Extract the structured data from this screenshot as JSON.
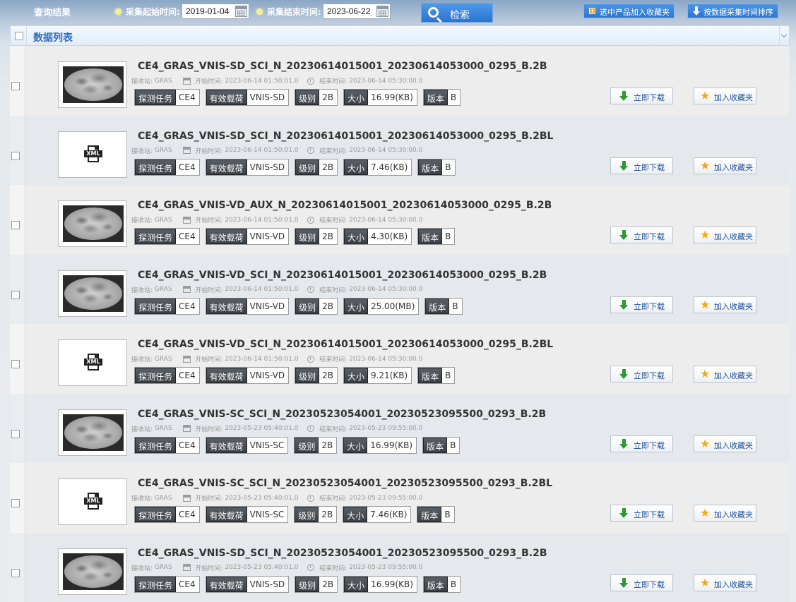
{
  "header": {
    "title": "查询结果",
    "start_label": "采集起始时间:",
    "start_value": "2019-01-04",
    "end_label": "采集结束时间:",
    "end_value": "2023-06-22",
    "search_label": "检索",
    "add_selected_label": "选中产品加入收藏夹",
    "sort_label": "按数据采集时间排序"
  },
  "list": {
    "title": "数据列表"
  },
  "labels": {
    "station": "接收站:",
    "start": "开始时间:",
    "end": "结束时间:",
    "task": "探测任务",
    "payload": "有效载荷",
    "level": "级别",
    "size": "大小",
    "version": "版本",
    "download": "立即下载",
    "favorite": "加入收藏夹"
  },
  "rows": [
    {
      "name": "CE4_GRAS_VNIS-SD_SCI_N_20230614015001_20230614053000_0295_B.2B",
      "thumb": "moon",
      "station": "GRAS",
      "start": "2023-06-14 01:50:01.0",
      "end": "2023-06-14 05:30:00.0",
      "task": "CE4",
      "payload": "VNIS-SD",
      "level": "2B",
      "size": "16.99(KB)",
      "version": "B"
    },
    {
      "name": "CE4_GRAS_VNIS-SD_SCI_N_20230614015001_20230614053000_0295_B.2BL",
      "thumb": "xml",
      "station": "GRAS",
      "start": "2023-06-14 01:50:01.0",
      "end": "2023-06-14 05:30:00.0",
      "task": "CE4",
      "payload": "VNIS-SD",
      "level": "2B",
      "size": "7.46(KB)",
      "version": "B"
    },
    {
      "name": "CE4_GRAS_VNIS-VD_AUX_N_20230614015001_20230614053000_0295_B.2B",
      "thumb": "moon",
      "station": "GRAS",
      "start": "2023-06-14 01:50:01.0",
      "end": "2023-06-14 05:30:00.0",
      "task": "CE4",
      "payload": "VNIS-VD",
      "level": "2B",
      "size": "4.30(KB)",
      "version": "B"
    },
    {
      "name": "CE4_GRAS_VNIS-VD_SCI_N_20230614015001_20230614053000_0295_B.2B",
      "thumb": "moon",
      "station": "GRAS",
      "start": "2023-06-14 01:50:01.0",
      "end": "2023-06-14 05:30:00.0",
      "task": "CE4",
      "payload": "VNIS-VD",
      "level": "2B",
      "size": "25.00(MB)",
      "version": "B"
    },
    {
      "name": "CE4_GRAS_VNIS-VD_SCI_N_20230614015001_20230614053000_0295_B.2BL",
      "thumb": "xml",
      "station": "GRAS",
      "start": "2023-06-14 01:50:01.0",
      "end": "2023-06-14 05:30:00.0",
      "task": "CE4",
      "payload": "VNIS-VD",
      "level": "2B",
      "size": "9.21(KB)",
      "version": "B"
    },
    {
      "name": "CE4_GRAS_VNIS-SC_SCI_N_20230523054001_20230523095500_0293_B.2B",
      "thumb": "moon",
      "station": "GRAS",
      "start": "2023-05-23 05:40:01.0",
      "end": "2023-05-23 09:55:00.0",
      "task": "CE4",
      "payload": "VNIS-SC",
      "level": "2B",
      "size": "16.99(KB)",
      "version": "B"
    },
    {
      "name": "CE4_GRAS_VNIS-SC_SCI_N_20230523054001_20230523095500_0293_B.2BL",
      "thumb": "xml",
      "station": "GRAS",
      "start": "2023-05-23 05:40:01.0",
      "end": "2023-05-23 09:55:00.0",
      "task": "CE4",
      "payload": "VNIS-SC",
      "level": "2B",
      "size": "7.46(KB)",
      "version": "B"
    },
    {
      "name": "CE4_GRAS_VNIS-SD_SCI_N_20230523054001_20230523095500_0293_B.2B",
      "thumb": "moon",
      "station": "GRAS",
      "start": "2023-05-23 05:40:01.0",
      "end": "2023-05-23 09:55:00.0",
      "task": "CE4",
      "payload": "VNIS-SD",
      "level": "2B",
      "size": "16.99(KB)",
      "version": "B"
    }
  ]
}
